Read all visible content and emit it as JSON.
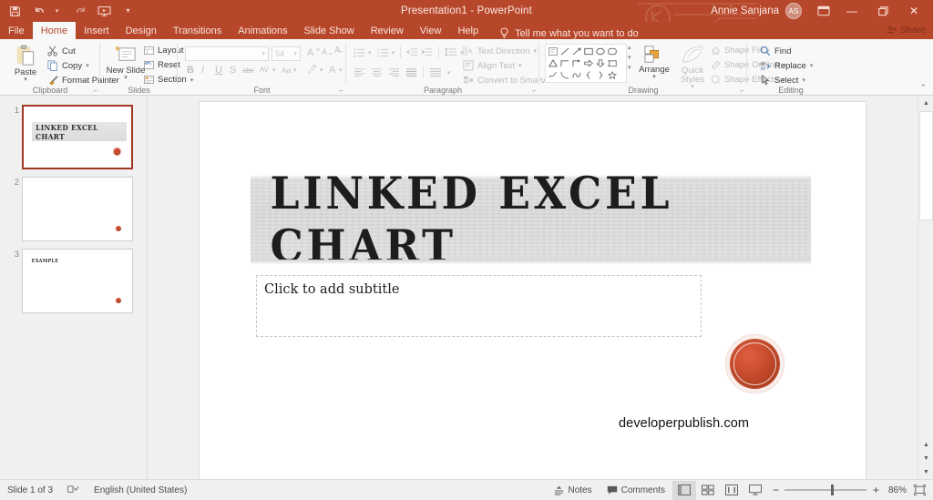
{
  "window": {
    "title": "Presentation1  -  PowerPoint",
    "account_name": "Annie Sanjana",
    "account_initials": "AS",
    "accent_color": "#b7472a"
  },
  "quick_access": [
    {
      "name": "save-icon",
      "label": "Save"
    },
    {
      "name": "undo-icon",
      "label": "Undo"
    },
    {
      "name": "redo-icon",
      "label": "Redo"
    },
    {
      "name": "start-slideshow-icon",
      "label": "Start From Beginning"
    },
    {
      "name": "customize-qat-icon",
      "label": "Customize Quick Access Toolbar"
    }
  ],
  "window_controls": {
    "ribbon_display": "Ribbon Display Options",
    "minimize": "—",
    "restore": "❐",
    "close": "✕",
    "share": "Share"
  },
  "tabs": [
    {
      "label": "File",
      "active": false
    },
    {
      "label": "Home",
      "active": true
    },
    {
      "label": "Insert",
      "active": false
    },
    {
      "label": "Design",
      "active": false
    },
    {
      "label": "Transitions",
      "active": false
    },
    {
      "label": "Animations",
      "active": false
    },
    {
      "label": "Slide Show",
      "active": false
    },
    {
      "label": "Review",
      "active": false
    },
    {
      "label": "View",
      "active": false
    },
    {
      "label": "Help",
      "active": false
    }
  ],
  "tellme": {
    "placeholder": "Tell me what you want to do"
  },
  "ribbon": {
    "clipboard": {
      "group_label": "Clipboard",
      "paste": "Paste",
      "cut": "Cut",
      "copy": "Copy",
      "format_painter": "Format Painter"
    },
    "slides": {
      "group_label": "Slides",
      "new_slide": "New Slide",
      "layout": "Layout",
      "reset": "Reset",
      "section": "Section"
    },
    "font": {
      "group_label": "Font",
      "font_name": "",
      "font_size": "54",
      "increase_size": "A",
      "decrease_size": "A",
      "clear_formatting": "Clear All Formatting",
      "bold": "B",
      "italic": "I",
      "underline": "U",
      "shadow": "S",
      "strikethrough": "abc",
      "character_spacing": "AV",
      "change_case": "Aa",
      "text_highlight": "Text Highlight Color",
      "font_color": "A"
    },
    "paragraph": {
      "group_label": "Paragraph",
      "text_direction": "Text Direction",
      "align_text": "Align Text",
      "convert_to_smartart": "Convert to SmartArt"
    },
    "drawing": {
      "group_label": "Drawing",
      "arrange": "Arrange",
      "quick_styles": "Quick Styles",
      "shape_fill": "Shape Fill",
      "shape_outline": "Shape Outline",
      "shape_effects": "Shape Effects"
    },
    "editing": {
      "group_label": "Editing",
      "find": "Find",
      "replace": "Replace",
      "select": "Select"
    },
    "collapse": "Collapse the Ribbon"
  },
  "slides_panel": [
    {
      "number": "1",
      "title": "LINKED EXCEL CHART",
      "selected": true
    },
    {
      "number": "2",
      "title": "",
      "selected": false
    },
    {
      "number": "3",
      "title": "EXAMPLE",
      "selected": false
    }
  ],
  "slide": {
    "title": "LINKED EXCEL CHART",
    "subtitle_placeholder": "Click to add subtitle",
    "watermark": "developerpublish.com"
  },
  "statusbar": {
    "slide_counter": "Slide 1 of 3",
    "language": "English (United States)",
    "notes": "Notes",
    "comments": "Comments",
    "views": [
      {
        "name": "normal-view-button",
        "label": "Normal",
        "active": true
      },
      {
        "name": "slide-sorter-button",
        "label": "Slide Sorter",
        "active": false
      },
      {
        "name": "reading-view-button",
        "label": "Reading View",
        "active": false
      },
      {
        "name": "slideshow-button",
        "label": "Slide Show",
        "active": false
      }
    ],
    "zoom_out": "−",
    "zoom_in": "+",
    "zoom_level": "86%",
    "fit_to_window": "Fit slide to current window"
  }
}
